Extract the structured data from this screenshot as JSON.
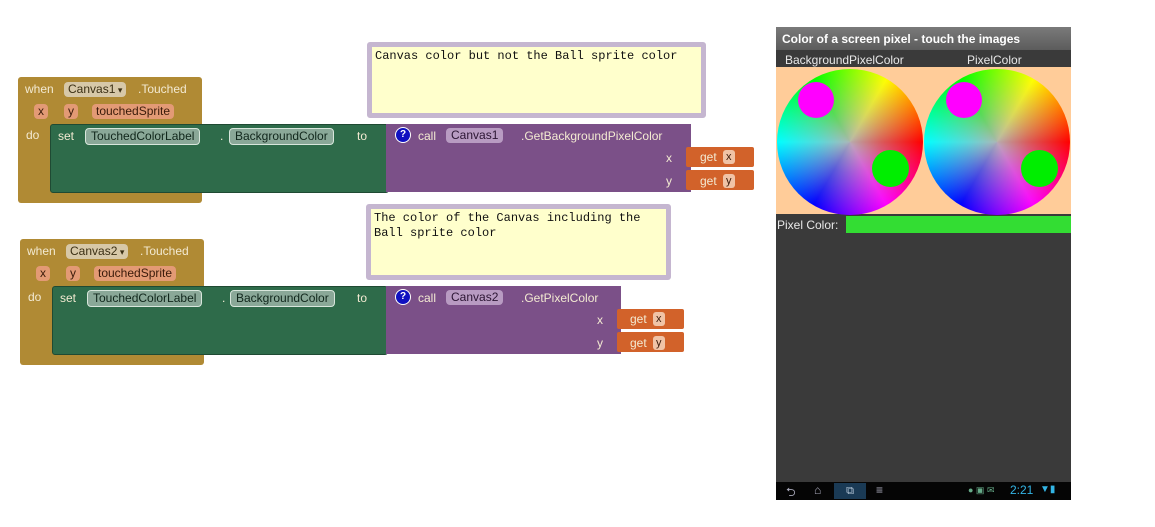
{
  "blocks": [
    {
      "when": "when",
      "component": "Canvas1",
      "event": ".Touched",
      "params": [
        "x",
        "y",
        "touchedSprite"
      ],
      "do": "do",
      "set": "set",
      "set_component": "TouchedColorLabel",
      "dot": ".",
      "property": "BackgroundColor",
      "to": "to",
      "call": "call",
      "call_component": "Canvas1",
      "method": ".GetBackgroundPixelColor",
      "arg_x": "x",
      "arg_y": "y",
      "get": "get",
      "get_x": "x",
      "get_y": "y",
      "comment": "Canvas color but not the Ball sprite color"
    },
    {
      "when": "when",
      "component": "Canvas2",
      "event": ".Touched",
      "params": [
        "x",
        "y",
        "touchedSprite"
      ],
      "do": "do",
      "set": "set",
      "set_component": "TouchedColorLabel",
      "dot": ".",
      "property": "BackgroundColor",
      "to": "to",
      "call": "call",
      "call_component": "Canvas2",
      "method": ".GetPixelColor",
      "arg_x": "x",
      "arg_y": "y",
      "get": "get",
      "get_x": "x",
      "get_y": "y",
      "comment": "The color of the Canvas including the Ball sprite color"
    }
  ],
  "comment_icon": "?",
  "phone": {
    "title": "Color of a screen pixel - touch the images",
    "canvas1_label": "BackgroundPixelColor",
    "canvas2_label": "PixelColor",
    "pixel_color_label": "Pixel Color:",
    "pixel_color_value": "#33dd33",
    "clock": "2:21",
    "nav_icons": [
      "back-icon",
      "home-icon",
      "recent-apps-icon",
      "menu-icon"
    ]
  },
  "colors": {
    "event_block": "#b08a34",
    "setter_block": "#2e6b4a",
    "call_block": "#7b5088",
    "get_block": "#d2622a",
    "ball_magenta": "#ff00ff",
    "ball_green": "#00ee00",
    "canvas_bg": "#ffcc99",
    "phone_bg": "#3a3a3a"
  }
}
